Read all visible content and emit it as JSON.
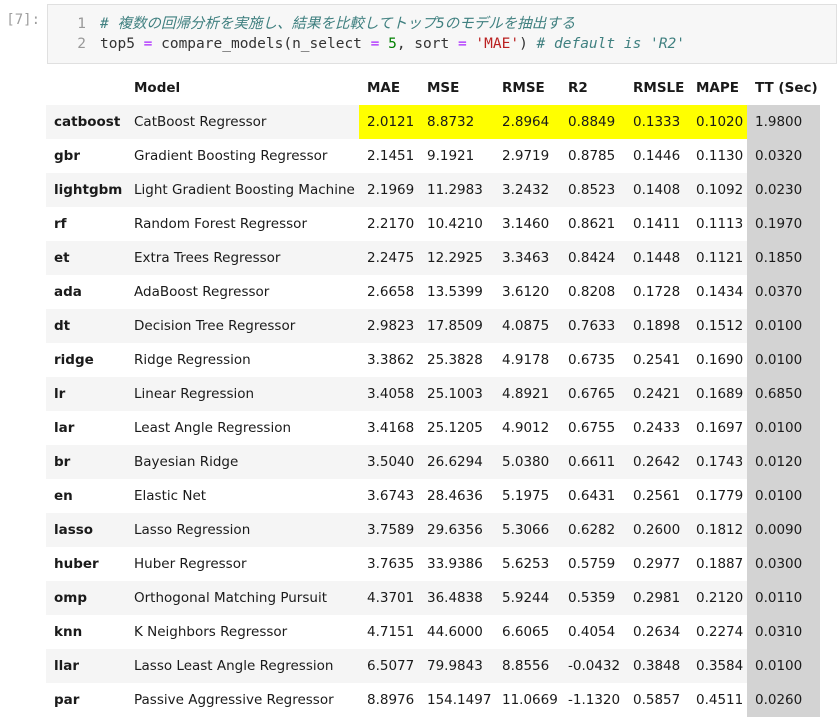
{
  "cell": {
    "prompt": "[7]:",
    "line_numbers": [
      "1",
      "2"
    ],
    "line1_comment": "# 複数の回帰分析を実施し、結果を比較してトップ5のモデルを抽出する",
    "line2": {
      "t1": "top5 ",
      "eq1": "=",
      "t2": " compare_models(n_select ",
      "eq2": "=",
      "sp": " ",
      "num": "5",
      "t3": ", sort ",
      "eq3": "=",
      "sp2": " ",
      "str": "'MAE'",
      "t4": ") ",
      "comment": "# default is 'R2'"
    }
  },
  "table": {
    "columns": [
      "",
      "Model",
      "MAE",
      "MSE",
      "RMSE",
      "R2",
      "RMSLE",
      "MAPE",
      "TT (Sec)"
    ],
    "highlight_color": "#ffff00",
    "time_column_color": "#d3d3d3",
    "rows": [
      {
        "id": "catboost",
        "model": "CatBoost Regressor",
        "mae": "2.0121",
        "mse": "8.8732",
        "rmse": "2.8964",
        "r2": "0.8849",
        "rmsle": "0.1333",
        "mape": "0.1020",
        "tt": "1.9800"
      },
      {
        "id": "gbr",
        "model": "Gradient Boosting Regressor",
        "mae": "2.1451",
        "mse": "9.1921",
        "rmse": "2.9719",
        "r2": "0.8785",
        "rmsle": "0.1446",
        "mape": "0.1130",
        "tt": "0.0320"
      },
      {
        "id": "lightgbm",
        "model": "Light Gradient Boosting Machine",
        "mae": "2.1969",
        "mse": "11.2983",
        "rmse": "3.2432",
        "r2": "0.8523",
        "rmsle": "0.1408",
        "mape": "0.1092",
        "tt": "0.0230"
      },
      {
        "id": "rf",
        "model": "Random Forest Regressor",
        "mae": "2.2170",
        "mse": "10.4210",
        "rmse": "3.1460",
        "r2": "0.8621",
        "rmsle": "0.1411",
        "mape": "0.1113",
        "tt": "0.1970"
      },
      {
        "id": "et",
        "model": "Extra Trees Regressor",
        "mae": "2.2475",
        "mse": "12.2925",
        "rmse": "3.3463",
        "r2": "0.8424",
        "rmsle": "0.1448",
        "mape": "0.1121",
        "tt": "0.1850"
      },
      {
        "id": "ada",
        "model": "AdaBoost Regressor",
        "mae": "2.6658",
        "mse": "13.5399",
        "rmse": "3.6120",
        "r2": "0.8208",
        "rmsle": "0.1728",
        "mape": "0.1434",
        "tt": "0.0370"
      },
      {
        "id": "dt",
        "model": "Decision Tree Regressor",
        "mae": "2.9823",
        "mse": "17.8509",
        "rmse": "4.0875",
        "r2": "0.7633",
        "rmsle": "0.1898",
        "mape": "0.1512",
        "tt": "0.0100"
      },
      {
        "id": "ridge",
        "model": "Ridge Regression",
        "mae": "3.3862",
        "mse": "25.3828",
        "rmse": "4.9178",
        "r2": "0.6735",
        "rmsle": "0.2541",
        "mape": "0.1690",
        "tt": "0.0100"
      },
      {
        "id": "lr",
        "model": "Linear Regression",
        "mae": "3.4058",
        "mse": "25.1003",
        "rmse": "4.8921",
        "r2": "0.6765",
        "rmsle": "0.2421",
        "mape": "0.1689",
        "tt": "0.6850"
      },
      {
        "id": "lar",
        "model": "Least Angle Regression",
        "mae": "3.4168",
        "mse": "25.1205",
        "rmse": "4.9012",
        "r2": "0.6755",
        "rmsle": "0.2433",
        "mape": "0.1697",
        "tt": "0.0100"
      },
      {
        "id": "br",
        "model": "Bayesian Ridge",
        "mae": "3.5040",
        "mse": "26.6294",
        "rmse": "5.0380",
        "r2": "0.6611",
        "rmsle": "0.2642",
        "mape": "0.1743",
        "tt": "0.0120"
      },
      {
        "id": "en",
        "model": "Elastic Net",
        "mae": "3.6743",
        "mse": "28.4636",
        "rmse": "5.1975",
        "r2": "0.6431",
        "rmsle": "0.2561",
        "mape": "0.1779",
        "tt": "0.0100"
      },
      {
        "id": "lasso",
        "model": "Lasso Regression",
        "mae": "3.7589",
        "mse": "29.6356",
        "rmse": "5.3066",
        "r2": "0.6282",
        "rmsle": "0.2600",
        "mape": "0.1812",
        "tt": "0.0090"
      },
      {
        "id": "huber",
        "model": "Huber Regressor",
        "mae": "3.7635",
        "mse": "33.9386",
        "rmse": "5.6253",
        "r2": "0.5759",
        "rmsle": "0.2977",
        "mape": "0.1887",
        "tt": "0.0300"
      },
      {
        "id": "omp",
        "model": "Orthogonal Matching Pursuit",
        "mae": "4.3701",
        "mse": "36.4838",
        "rmse": "5.9244",
        "r2": "0.5359",
        "rmsle": "0.2981",
        "mape": "0.2120",
        "tt": "0.0110"
      },
      {
        "id": "knn",
        "model": "K Neighbors Regressor",
        "mae": "4.7151",
        "mse": "44.6000",
        "rmse": "6.6065",
        "r2": "0.4054",
        "rmsle": "0.2634",
        "mape": "0.2274",
        "tt": "0.0310"
      },
      {
        "id": "llar",
        "model": "Lasso Least Angle Regression",
        "mae": "6.5077",
        "mse": "79.9843",
        "rmse": "8.8556",
        "r2": "-0.0432",
        "rmsle": "0.3848",
        "mape": "0.3584",
        "tt": "0.0100"
      },
      {
        "id": "par",
        "model": "Passive Aggressive Regressor",
        "mae": "8.8976",
        "mse": "154.1497",
        "rmse": "11.0669",
        "r2": "-1.1320",
        "rmsle": "0.5857",
        "mape": "0.4511",
        "tt": "0.0260"
      }
    ]
  }
}
